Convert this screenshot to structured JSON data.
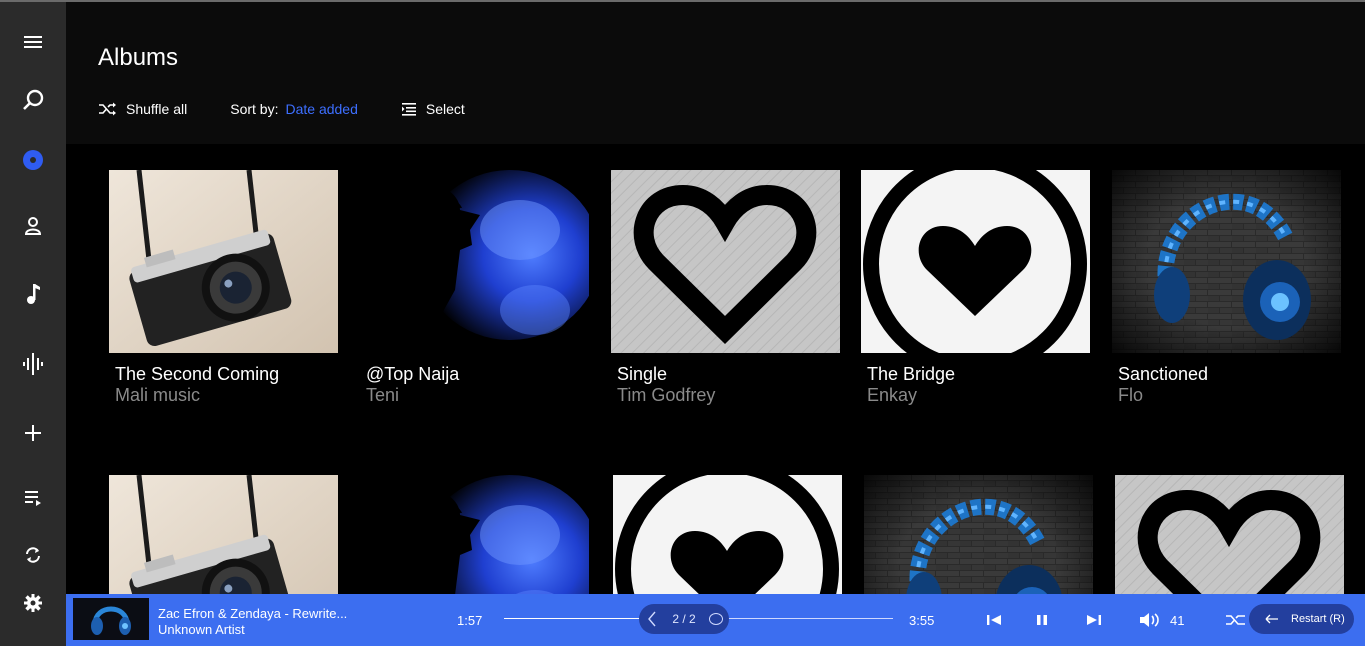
{
  "page": {
    "title": "Albums"
  },
  "toolbar": {
    "shuffle_label": "Shuffle all",
    "sort_label": "Sort by:",
    "sort_value": "Date added",
    "select_label": "Select"
  },
  "sidebar": {
    "items": [
      {
        "icon": "hamburger-menu-icon"
      },
      {
        "icon": "search-icon"
      },
      {
        "icon": "album-icon",
        "active": true
      },
      {
        "icon": "artist-icon"
      },
      {
        "icon": "music-note-icon"
      },
      {
        "icon": "waveform-icon"
      },
      {
        "icon": "plus-icon"
      },
      {
        "icon": "queue-icon"
      },
      {
        "icon": "refresh-icon"
      },
      {
        "icon": "settings-gear-icon"
      }
    ]
  },
  "albums": [
    {
      "title": "The Second Coming",
      "artist": "Mali music",
      "art": "camera"
    },
    {
      "title": "@Top Naija",
      "artist": "Teni",
      "art": "smoke"
    },
    {
      "title": "Single",
      "artist": "Tim Godfrey",
      "art": "heart-outline"
    },
    {
      "title": "The Bridge",
      "artist": "Enkay",
      "art": "heart-circle"
    },
    {
      "title": "Sanctioned",
      "artist": "Flo",
      "art": "headphones"
    },
    {
      "title": "",
      "artist": "",
      "art": "camera"
    },
    {
      "title": "",
      "artist": "",
      "art": "smoke"
    },
    {
      "title": "",
      "artist": "",
      "art": "heart-circle"
    },
    {
      "title": "",
      "artist": "",
      "art": "headphones"
    },
    {
      "title": "",
      "artist": "",
      "art": "heart-outline"
    }
  ],
  "player": {
    "track": "Zac Efron & Zendaya - Rewrite...",
    "artist": "Unknown Artist",
    "elapsed": "1:57",
    "total": "3:55",
    "progress": 0.5,
    "pager": "2 / 2",
    "volume": "41",
    "restart_label": "Restart (R)"
  },
  "colors": {
    "accent": "#3c6ef0",
    "sort_value": "#3d6fff",
    "sidebar": "#2b2b2b"
  }
}
